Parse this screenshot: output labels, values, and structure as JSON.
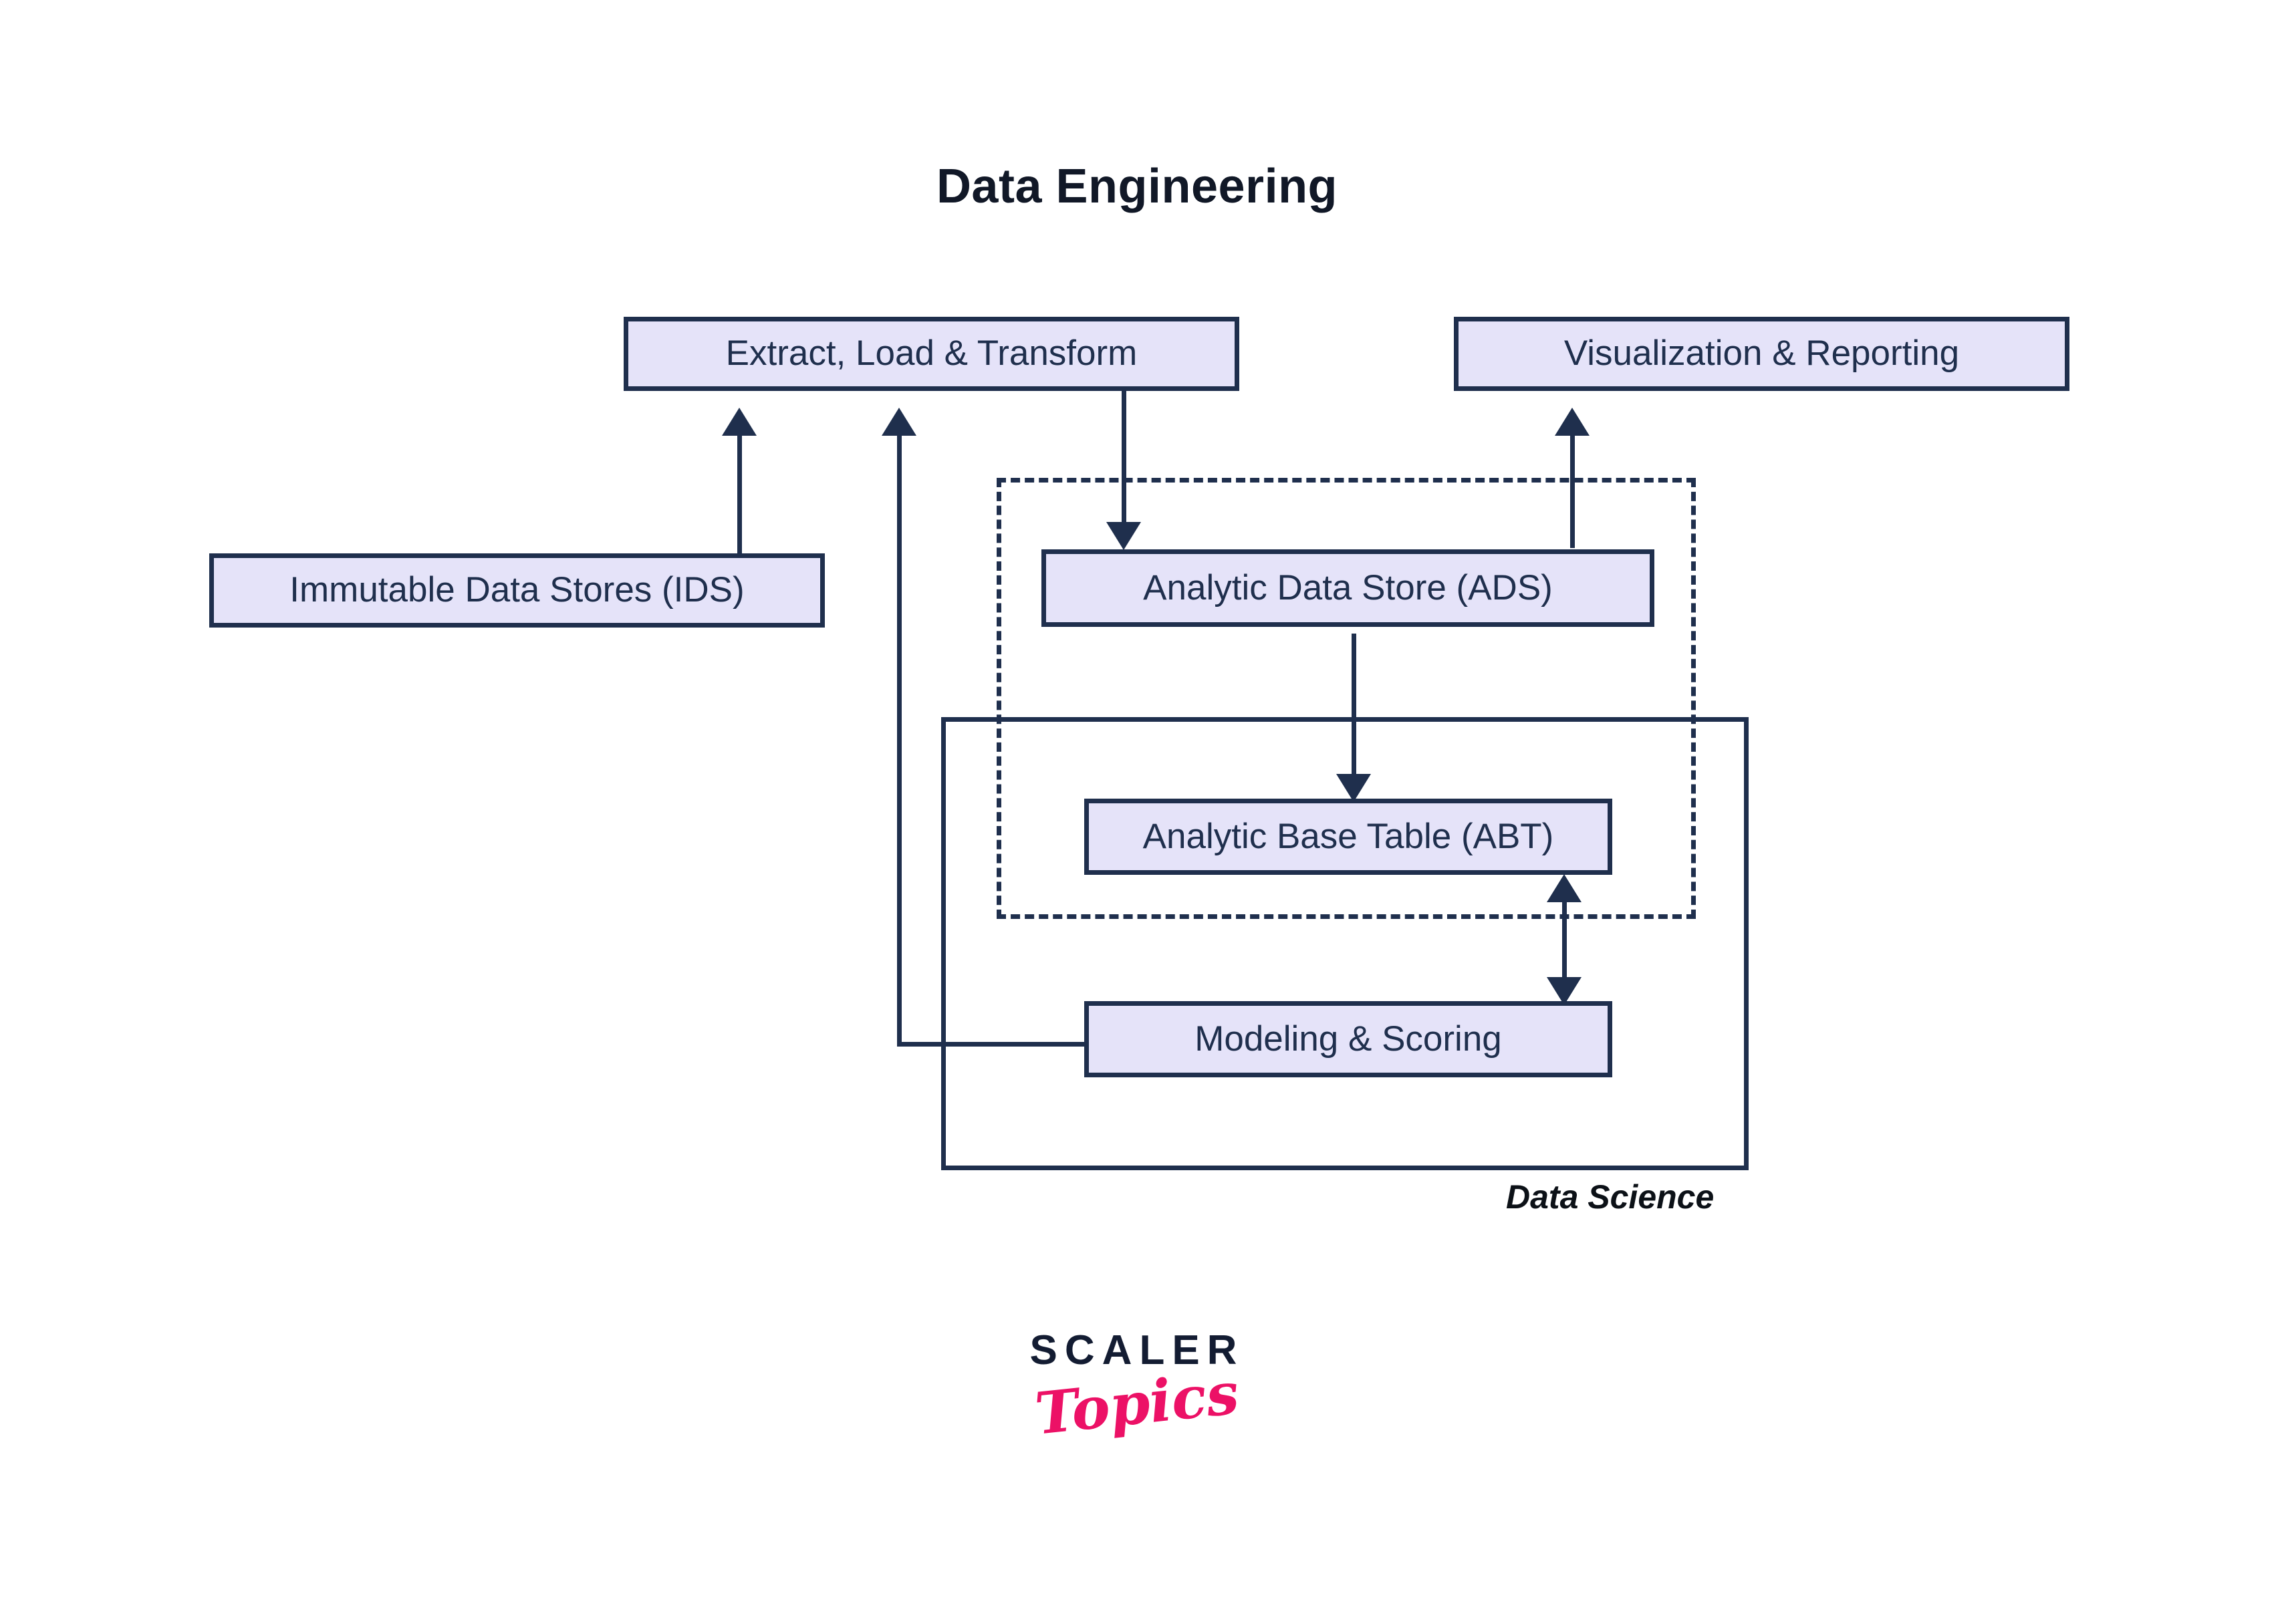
{
  "title": "Data Engineering",
  "colors": {
    "node_fill": "#E5E3F9",
    "node_border": "#1F2F4D",
    "node_text": "#1F2F4D",
    "title_text": "#111827",
    "logo_dark": "#131C32",
    "logo_pink": "#EC1166",
    "background": "#FFFFFF"
  },
  "nodes": {
    "elt": "Extract, Load & Transform",
    "visualization": "Visualization & Reporting",
    "ids": "Immutable Data Stores (IDS)",
    "ads": "Analytic Data Store (ADS)",
    "abt": "Analytic Base Table (ABT)",
    "modeling": "Modeling & Scoring"
  },
  "frames": {
    "dashed_group_label": "",
    "data_science_label": "Data Science"
  },
  "edges": [
    {
      "from": "ids",
      "to": "elt",
      "direction": "up",
      "style": "solid"
    },
    {
      "from": "modeling",
      "to": "elt",
      "direction": "up",
      "style": "solid"
    },
    {
      "from": "elt",
      "to": "ads",
      "direction": "down",
      "style": "solid"
    },
    {
      "from": "ads",
      "to": "visualization",
      "direction": "up",
      "style": "solid"
    },
    {
      "from": "ads",
      "to": "abt",
      "direction": "down",
      "style": "solid"
    },
    {
      "from": "abt",
      "to": "modeling",
      "direction": "both",
      "style": "solid"
    }
  ],
  "logo": {
    "primary": "SCALER",
    "secondary": "Topics"
  }
}
